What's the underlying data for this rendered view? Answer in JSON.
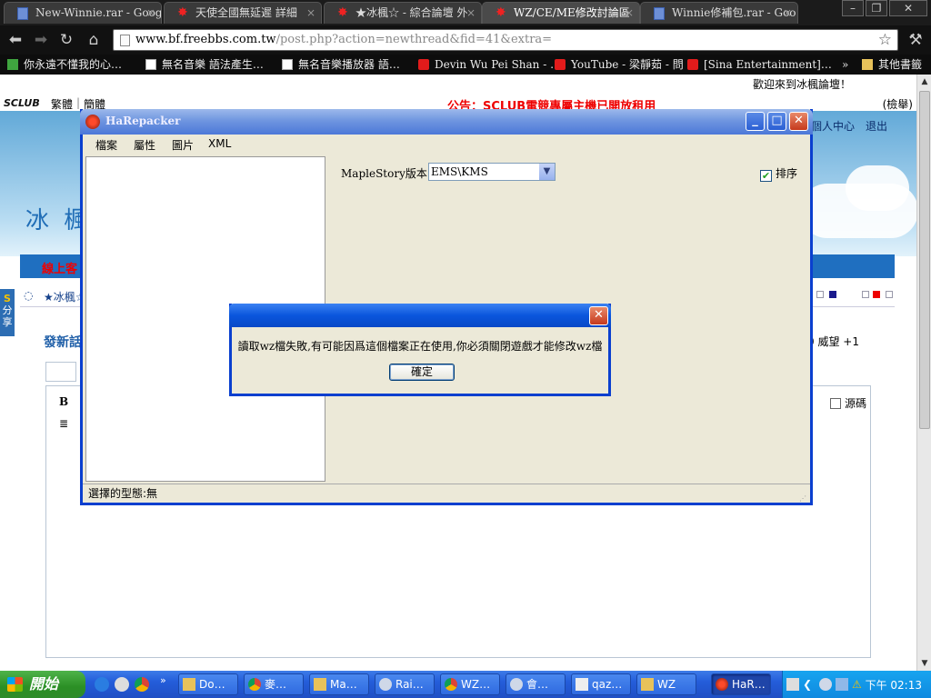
{
  "browser": {
    "tabs": [
      {
        "label": "New-Winnie.rar - Google",
        "icon": "doc-icon",
        "active": false
      },
      {
        "label": "天使全國無延遲 詳細",
        "icon": "maple-icon",
        "active": false
      },
      {
        "label": "★冰楓☆ - 綜合論壇 外",
        "icon": "maple-icon",
        "active": false
      },
      {
        "label": "WZ/CE/ME修改討論區",
        "icon": "maple-icon",
        "active": true
      },
      {
        "label": "Winnie修補包.rar - Goo",
        "icon": "doc-icon",
        "active": false
      }
    ],
    "url_host": "www.bf.freebbs.com.tw",
    "url_path": "/post.php?action=newthread&fid=41&extra=",
    "bookmarks": [
      "你永遠不懂我的心…",
      "無名音樂 語法產生…",
      "無名音樂播放器 語…",
      "Devin Wu Pei Shan - …",
      "YouTube - 梁靜茹 - 問",
      "[Sina Entertainment]…",
      "其他書籤"
    ]
  },
  "site": {
    "welcome": "歡迎來到冰楓論壇！",
    "logo": "SCLUB",
    "lang_trad": "繁體",
    "lang_simp": "簡體",
    "announcement": "公告：SCLUB電競專屬主機已開放租用",
    "search_link": "(檢舉)",
    "user_center": "個人中心",
    "logout": "退出",
    "hero_logo": "冰  楓",
    "online_label": "線上客",
    "forum_link": "★冰楓☆",
    "share_label": "分享",
    "post_title": "發新話",
    "prestige": "0  威望 +1",
    "bold_btn": "B",
    "source_label": "源碼"
  },
  "harepacker": {
    "title": "HaRepacker",
    "menu": [
      "檔案",
      "屬性",
      "圖片",
      "XML"
    ],
    "version_label": "MapleStory版本：",
    "version_value": "EMS\\KMS",
    "sort_label": "排序",
    "sort_checked": true,
    "status": "選擇的型態:無"
  },
  "dialog": {
    "message": "讀取wz檔失敗,有可能因爲這個檔案正在使用,你必須關閉遊戲才能修改wz檔",
    "ok_label": "確定"
  },
  "taskbar": {
    "start_label": "開始",
    "tasks": [
      "Do…",
      "麥…",
      "Ma…",
      "Rai…",
      "WZ…",
      "會…",
      "qaz…",
      "WZ",
      "HaR…"
    ],
    "clock": "下午 02:13"
  }
}
